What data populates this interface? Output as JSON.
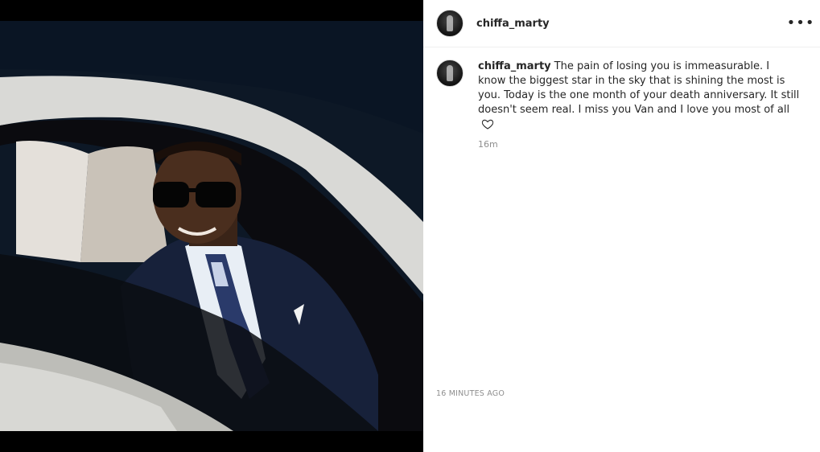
{
  "post": {
    "username": "chiffa_marty",
    "more_icon": "more-horizontal-icon",
    "caption": {
      "username": "chiffa_marty",
      "text": "The pain of losing you is immeasurable. I know the biggest star in the sky that is shining the most is you. Today is the one month of your death anniversary. It still doesn't seem real. I miss you Van and I love you most of all",
      "emoji_icon": "heart-outline-icon",
      "relative_time": "16m"
    },
    "timestamp": "16 MINUTES AGO"
  }
}
